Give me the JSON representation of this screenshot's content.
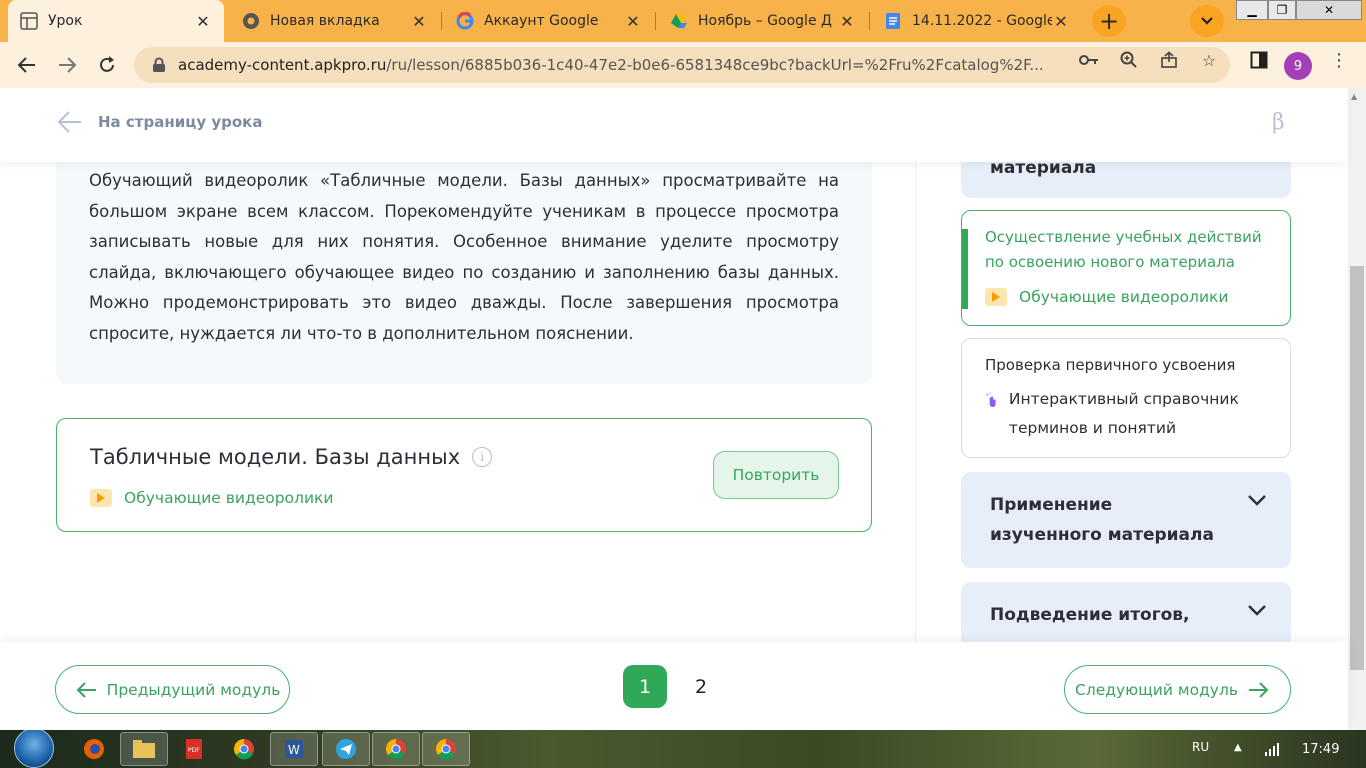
{
  "browser": {
    "tabs": [
      {
        "title": "Урок",
        "icon": "grid-icon",
        "active": true
      },
      {
        "title": "Новая вкладка",
        "icon": "chrome-icon",
        "active": false
      },
      {
        "title": "Аккаунт Google",
        "icon": "google-icon",
        "active": false
      },
      {
        "title": "Ноябрь – Google Д",
        "icon": "drive-icon",
        "active": false
      },
      {
        "title": "14.11.2022 - Google",
        "icon": "docs-icon",
        "active": false
      }
    ],
    "new_tab_label": "+",
    "url_host": "academy-content.apkpro.ru",
    "url_path": "/ru/lesson/6885b036-1c40-47e2-b0e6-6581348ce9bc?backUrl=%2Fru%2Fcatalog%2F...",
    "profile_label": "9"
  },
  "header": {
    "back_label": "На страницу урока",
    "beta_label": "β"
  },
  "main": {
    "info_text": "Обучающий видеоролик «Табличные модели. Базы данных» просматривайте на большом экране всем классом. Порекомендуйте ученикам в процессе просмотра записывать новые для них понятия. Особенное внимание уделите просмотру слайда, включающего обучающее видео по созданию и заполнению базы данных. Можно продемонстрировать это видео дважды. После завершения просмотра спросите, нуждается ли что-то в дополнительном пояснении.",
    "resource": {
      "title": "Табличные модели. Базы данных",
      "type_label": "Обучающие видеоролики",
      "repeat_label": "Повторить"
    }
  },
  "sidebar": {
    "top_partial": "материала",
    "current_step": {
      "title": "Осуществление учебных действий по освоению нового материала",
      "item": "Обучающие видеоролики"
    },
    "check_step": {
      "title": "Проверка первичного усвоения",
      "item": "Интерактивный справочник терминов и понятий"
    },
    "groups": [
      {
        "label": "Применение изученного материала"
      },
      {
        "label": "Подведение итогов,"
      }
    ]
  },
  "footer": {
    "prev_label": "Предыдущий модуль",
    "next_label": "Следующий модуль",
    "pages": [
      "1",
      "2"
    ],
    "current_page": "1"
  },
  "taskbar": {
    "lang": "RU",
    "time": "17:49"
  },
  "colors": {
    "accent_green": "#3aa35f",
    "tab_strip": "#f7b24a",
    "card_bg": "#f5f8fc",
    "group_bg": "#e7eefa"
  }
}
